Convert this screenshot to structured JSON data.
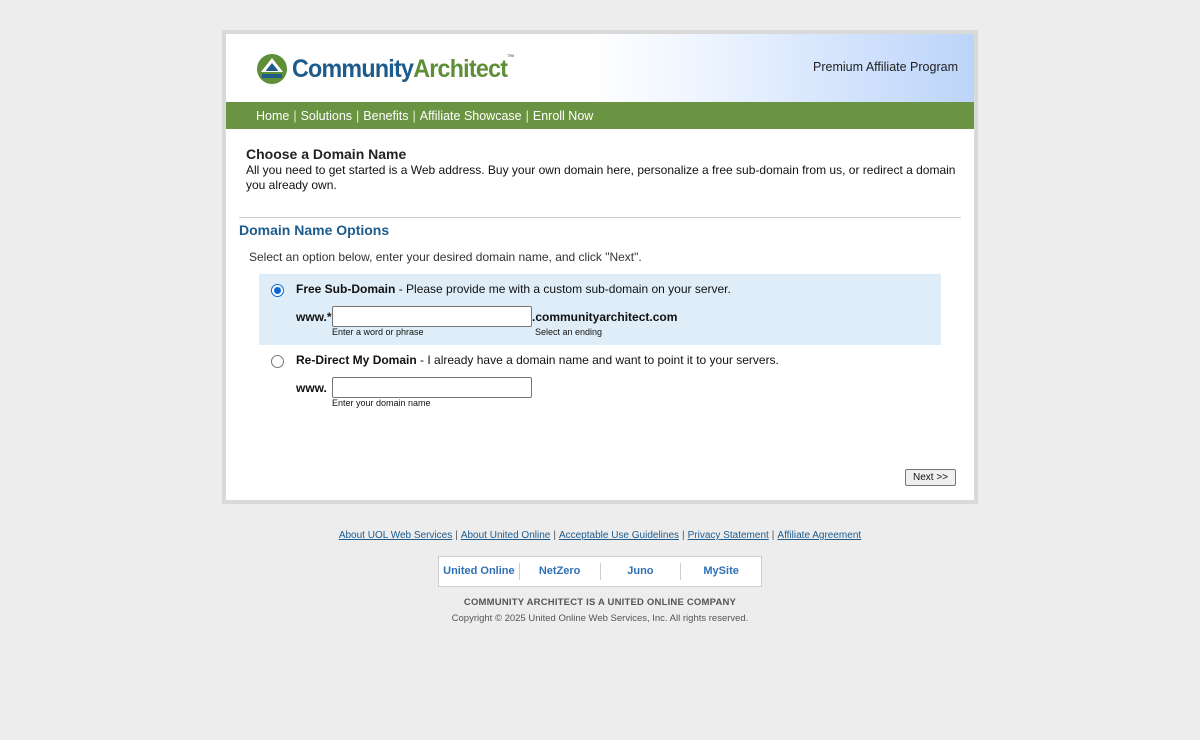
{
  "header": {
    "logo": {
      "word1": "Community",
      "word2": "Architect",
      "trademark": "™"
    },
    "program_title": "Premium Affiliate Program"
  },
  "nav": {
    "items": [
      {
        "label": "Home"
      },
      {
        "label": "Solutions"
      },
      {
        "label": "Benefits"
      },
      {
        "label": "Affiliate Showcase"
      },
      {
        "label": "Enroll Now"
      }
    ],
    "separator": "|"
  },
  "intro": {
    "heading": "Choose a Domain Name",
    "text": "All you need to get started is a Web address. Buy your own domain here, personalize a free sub-domain from us, or redirect a domain you already own."
  },
  "section": {
    "title": "Domain Name Options",
    "instructions": "Select an option below, enter your desired domain name, and click \"Next\"."
  },
  "options": [
    {
      "title": "Free Sub-Domain",
      "description": " - Please provide me with a custom sub-domain on your server.",
      "selected": true,
      "prefix": "www.*",
      "input_value": "",
      "suffix": ".communityarchitect.com",
      "input_hint": "Enter a word or phrase",
      "suffix_hint": "Select an ending"
    },
    {
      "title": "Re-Direct My Domain",
      "description": " - I already have a domain name and want to point it to your servers.",
      "selected": false,
      "prefix": "www.",
      "input_value": "",
      "input_hint": "Enter your domain name"
    }
  ],
  "next_button": "Next >>",
  "footer": {
    "links": [
      {
        "label": "About UOL Web Services"
      },
      {
        "label": "About United Online"
      },
      {
        "label": "Acceptable Use Guidelines"
      },
      {
        "label": "Privacy Statement"
      },
      {
        "label": "Affiliate Agreement"
      }
    ],
    "separator": "|",
    "brands": [
      {
        "label": "United Online"
      },
      {
        "label": "NetZero"
      },
      {
        "label": "Juno"
      },
      {
        "label": "MySite"
      }
    ],
    "company": "COMMUNITY ARCHITECT IS A UNITED ONLINE COMPANY",
    "copyright": "Copyright © 2025 United Online Web Services, Inc. All rights reserved."
  },
  "colors": {
    "nav_green": "#6a9442",
    "brand_blue": "#1d5b8d",
    "brand_green": "#5f8e36",
    "selected_option_bg": "#deedf8",
    "page_bg": "#ededed"
  }
}
